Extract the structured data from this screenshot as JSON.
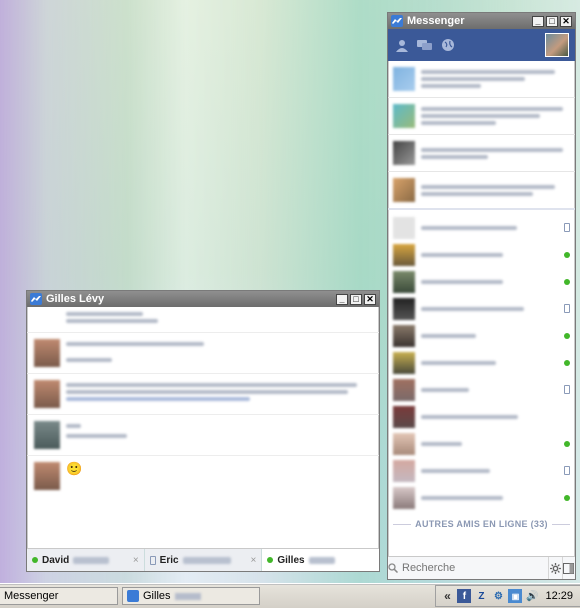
{
  "messenger": {
    "title": "Messenger",
    "online_section_label": "AUTRES AMIS EN LIGNE (33)",
    "search_placeholder": "Recherche"
  },
  "chat": {
    "title": "Gilles Lévy",
    "emoji": "🙂",
    "tabs": [
      {
        "label": "David",
        "status": "online"
      },
      {
        "label": "Eric",
        "status": "mobile"
      },
      {
        "label": "Gilles",
        "status": "online"
      }
    ],
    "close_glyph": "×"
  },
  "taskbar": {
    "items": [
      {
        "label": "Messenger"
      },
      {
        "label": "Gilles"
      }
    ],
    "clock": "12:29",
    "tray_chevron": "«"
  },
  "colors": {
    "facebook_blue": "#3b5998",
    "online_green": "#42b72a",
    "titlebar_gray": "#7d7d7d"
  }
}
